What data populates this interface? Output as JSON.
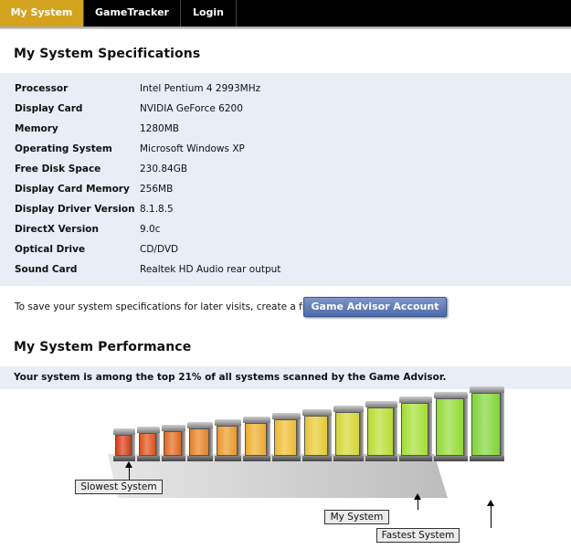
{
  "nav": {
    "tabs": [
      {
        "label": "My System",
        "active": true
      },
      {
        "label": "GameTracker",
        "active": false
      },
      {
        "label": "Login",
        "active": false
      }
    ]
  },
  "specs": {
    "title": "My System Specifications",
    "rows": [
      {
        "label": "Processor",
        "value": "Intel Pentium 4 2993MHz"
      },
      {
        "label": "Display Card",
        "value": "NVIDIA GeForce 6200"
      },
      {
        "label": "Memory",
        "value": "1280MB"
      },
      {
        "label": "Operating System",
        "value": "Microsoft Windows XP"
      },
      {
        "label": "Free Disk Space",
        "value": "230.84GB"
      },
      {
        "label": "Display Card Memory",
        "value": "256MB"
      },
      {
        "label": "Display Driver Version",
        "value": "8.1.8.5"
      },
      {
        "label": "DirectX Version",
        "value": "9.0c"
      },
      {
        "label": "Optical Drive",
        "value": "CD/DVD"
      },
      {
        "label": "Sound Card",
        "value": "Realtek HD Audio rear output"
      }
    ]
  },
  "save": {
    "text": "To save your system specifications for later visits, create a free",
    "button_label": "Game Advisor Account"
  },
  "performance": {
    "title": "My System Performance",
    "rank_text": "Your system is among the top 21% of all systems scanned by the Game Advisor.",
    "bar_count": 13,
    "my_system_bar_index": 10,
    "bar_colors": [
      "#d83a10",
      "#de5015",
      "#e2661a",
      "#e6801f",
      "#eb9724",
      "#eeaa28",
      "#eebb2c",
      "#e6c82e",
      "#d2d62e",
      "#b8dc2c",
      "#a2de2e",
      "#90da30",
      "#7ed434"
    ],
    "labels": {
      "slowest": "Slowest System",
      "mine": "My System",
      "fastest": "Fastest System"
    }
  }
}
